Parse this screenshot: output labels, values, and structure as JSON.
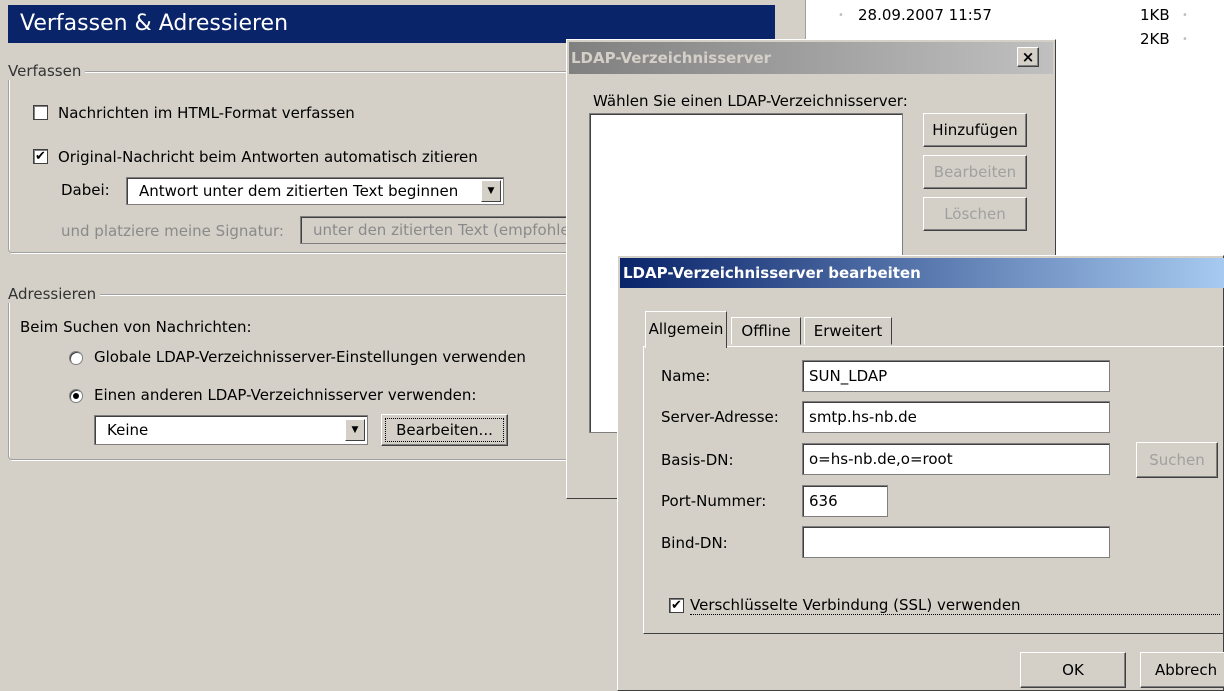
{
  "prefs": {
    "title": "Verfassen & Adressieren",
    "compose_group": "Verfassen",
    "html_format_label": "Nachrichten im HTML-Format verfassen",
    "html_format_checked": false,
    "quote_label": "Original-Nachricht beim Antworten automatisch zitieren",
    "quote_checked": true,
    "dabei_label": "Dabei:",
    "dabei_value": "Antwort unter dem zitierten Text beginnen",
    "signature_label": "und platziere meine Signatur:",
    "signature_value": "unter den zitierten Text (empfohle",
    "address_group": "Adressieren",
    "search_label": "Beim Suchen von Nachrichten:",
    "radio_global": "Globale LDAP-Verzeichnisserver-Einstellungen verwenden",
    "radio_other": "Einen anderen LDAP-Verzeichnisserver verwenden:",
    "server_select_value": "Keine",
    "edit_button": "Bearbeiten..."
  },
  "file_list": {
    "rows": [
      {
        "date": "28.09.2007 11:57",
        "size": "1KB"
      },
      {
        "date": "",
        "size": "2KB"
      }
    ]
  },
  "ldap_dialog": {
    "title": "LDAP-Verzeichnisserver",
    "close": "×",
    "prompt": "Wählen Sie einen LDAP-Verzeichnisserver:",
    "add_button": "Hinzufügen",
    "edit_button": "Bearbeiten",
    "delete_button": "Löschen"
  },
  "edit_dialog": {
    "title": "LDAP-Verzeichnisserver bearbeiten",
    "tabs": [
      "Allgemein",
      "Offline",
      "Erweitert"
    ],
    "name_label": "Name:",
    "name_value": "SUN_LDAP",
    "server_label": "Server-Adresse:",
    "server_value": "smtp.hs-nb.de",
    "basedn_label": "Basis-DN:",
    "basedn_value": "o=hs-nb.de,o=root",
    "search_button": "Suchen",
    "port_label": "Port-Nummer:",
    "port_value": "636",
    "binddn_label": "Bind-DN:",
    "binddn_value": "",
    "ssl_label": "Verschlüsselte Verbindung (SSL) verwenden",
    "ssl_checked": true,
    "ok_button": "OK",
    "cancel_button": "Abbrech"
  }
}
